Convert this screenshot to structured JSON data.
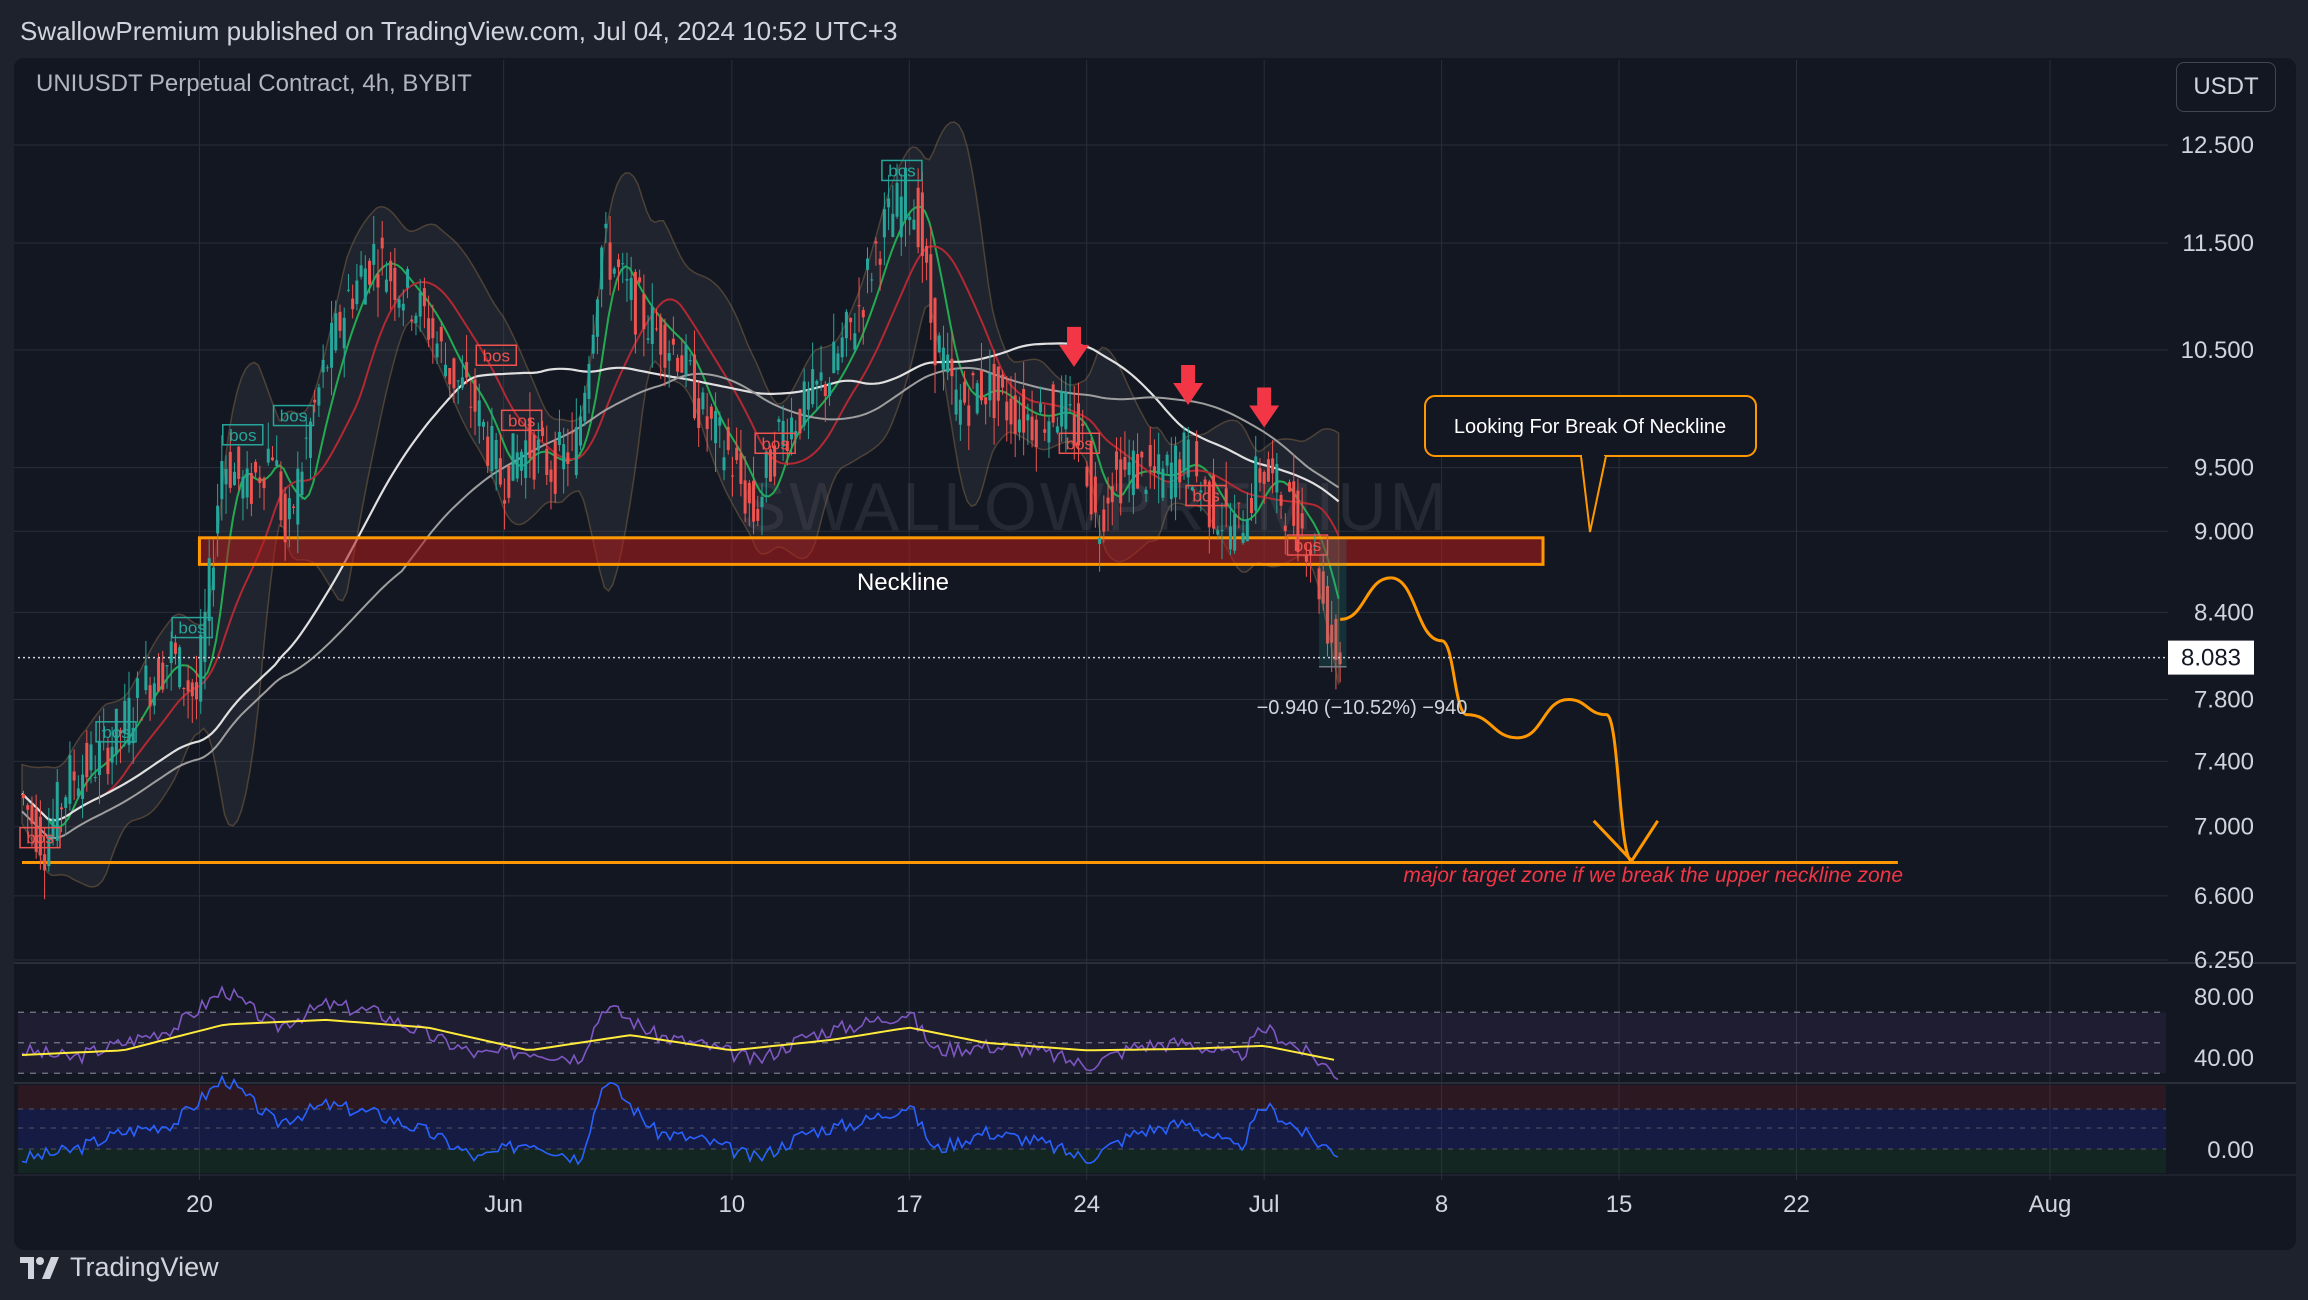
{
  "header": {
    "publish_line": "SwallowPremium published on TradingView.com, Jul 04, 2024 10:52 UTC+3"
  },
  "symbol": {
    "title": "UNIUSDT Perpetual Contract, 4h, BYBIT",
    "currency_button": "USDT"
  },
  "watermark": "SWALLOWPREMIUM",
  "footer": {
    "brand": "TradingView"
  },
  "colors": {
    "background": "#131722",
    "bull": "#26a69a",
    "bear": "#ef5350",
    "orange": "#ff9800",
    "rsi": "#7e57c2",
    "rsi_ma": "#ffeb3b",
    "osc": "#2962ff",
    "ema_fast": "#22ab52",
    "ema_mid": "#b22833",
    "ma_white": "#e0e0e0",
    "ma_grey": "#9e9e9e"
  },
  "chart_data": {
    "type": "candlestick",
    "interval": "4h",
    "price_axis": {
      "ticks": [
        12.5,
        11.5,
        10.5,
        9.5,
        9.0,
        8.4,
        7.8,
        7.4,
        7.0,
        6.6,
        6.25
      ],
      "tick_labels": [
        "12.500",
        "11.500",
        "10.500",
        "9.500",
        "9.000",
        "8.400",
        "7.800",
        "7.400",
        "7.000",
        "6.600",
        "6.250"
      ],
      "last_price": 8.083,
      "last_price_label": "8.083"
    },
    "time_axis": {
      "labels": [
        "20",
        "Jun",
        "10",
        "17",
        "24",
        "Jul",
        "8",
        "15",
        "22",
        "Aug"
      ],
      "dates": [
        "2024-05-20",
        "2024-06-01",
        "2024-06-10",
        "2024-06-17",
        "2024-06-24",
        "2024-07-01",
        "2024-07-08",
        "2024-07-15",
        "2024-07-22",
        "2024-08-01"
      ],
      "start": "2024-05-13",
      "end": "2024-08-04"
    },
    "price_path": [
      [
        "2024-05-13",
        7.2
      ],
      [
        "2024-05-14",
        6.9
      ],
      [
        "2024-05-15",
        7.3
      ],
      [
        "2024-05-16",
        7.4
      ],
      [
        "2024-05-17",
        7.6
      ],
      [
        "2024-05-18",
        7.9
      ],
      [
        "2024-05-19",
        8.1
      ],
      [
        "2024-05-20",
        7.8
      ],
      [
        "2024-05-20T12:00",
        8.6
      ],
      [
        "2024-05-21",
        9.6
      ],
      [
        "2024-05-22",
        9.3
      ],
      [
        "2024-05-23",
        9.7
      ],
      [
        "2024-05-23T12:00",
        8.9
      ],
      [
        "2024-05-24",
        9.4
      ],
      [
        "2024-05-25",
        10.3
      ],
      [
        "2024-05-26",
        11.0
      ],
      [
        "2024-05-27",
        11.4
      ],
      [
        "2024-05-28",
        11.1
      ],
      [
        "2024-05-29",
        10.8
      ],
      [
        "2024-05-30",
        10.3
      ],
      [
        "2024-05-31",
        10.0
      ],
      [
        "2024-06-01",
        9.4
      ],
      [
        "2024-06-02",
        9.7
      ],
      [
        "2024-06-03",
        9.5
      ],
      [
        "2024-06-04",
        9.7
      ],
      [
        "2024-06-05",
        11.5
      ],
      [
        "2024-06-06",
        11.0
      ],
      [
        "2024-06-07",
        10.7
      ],
      [
        "2024-06-08",
        10.5
      ],
      [
        "2024-06-09",
        9.9
      ],
      [
        "2024-06-10",
        9.6
      ],
      [
        "2024-06-11",
        9.1
      ],
      [
        "2024-06-12",
        9.8
      ],
      [
        "2024-06-13",
        10.0
      ],
      [
        "2024-06-14",
        10.3
      ],
      [
        "2024-06-15",
        10.8
      ],
      [
        "2024-06-16",
        11.6
      ],
      [
        "2024-06-17",
        12.0
      ],
      [
        "2024-06-17T12:00",
        11.7
      ],
      [
        "2024-06-18",
        10.7
      ],
      [
        "2024-06-19",
        10.0
      ],
      [
        "2024-06-20",
        10.2
      ],
      [
        "2024-06-21",
        10.0
      ],
      [
        "2024-06-22",
        9.9
      ],
      [
        "2024-06-23",
        10.0
      ],
      [
        "2024-06-24",
        9.7
      ],
      [
        "2024-06-24T12:00",
        9.0
      ],
      [
        "2024-06-25",
        9.4
      ],
      [
        "2024-06-26",
        9.5
      ],
      [
        "2024-06-27",
        9.4
      ],
      [
        "2024-06-28",
        9.6
      ],
      [
        "2024-06-29",
        9.2
      ],
      [
        "2024-06-30",
        9.0
      ],
      [
        "2024-07-01",
        9.5
      ],
      [
        "2024-07-02",
        9.2
      ],
      [
        "2024-07-03",
        8.9
      ],
      [
        "2024-07-03T12:00",
        8.4
      ],
      [
        "2024-07-04",
        8.083
      ]
    ],
    "bos_labels": [
      {
        "date": "2024-05-13",
        "price": 6.9,
        "text": "bos",
        "color": "bear"
      },
      {
        "date": "2024-05-16",
        "price": 7.55,
        "text": "bos",
        "color": "bull"
      },
      {
        "date": "2024-05-19",
        "price": 8.25,
        "text": "bos",
        "color": "bull"
      },
      {
        "date": "2024-05-21",
        "price": 9.72,
        "text": "bos",
        "color": "bull"
      },
      {
        "date": "2024-05-23",
        "price": 9.88,
        "text": "bos",
        "color": "bull"
      },
      {
        "date": "2024-05-31",
        "price": 10.4,
        "text": "bos",
        "color": "bear"
      },
      {
        "date": "2024-06-01",
        "price": 9.84,
        "text": "bos",
        "color": "bear"
      },
      {
        "date": "2024-06-11",
        "price": 9.65,
        "text": "bos",
        "color": "bear"
      },
      {
        "date": "2024-06-16",
        "price": 12.17,
        "text": "bos",
        "color": "bull"
      },
      {
        "date": "2024-06-23",
        "price": 9.65,
        "text": "bos",
        "color": "bear"
      },
      {
        "date": "2024-06-28",
        "price": 9.23,
        "text": "bos",
        "color": "bear"
      },
      {
        "date": "2024-07-02",
        "price": 8.85,
        "text": "bos",
        "color": "bear"
      }
    ],
    "down_arrows": [
      {
        "date": "2024-06-23T12:00",
        "price": 10.35
      },
      {
        "date": "2024-06-28",
        "price": 10.02
      },
      {
        "date": "2024-07-01",
        "price": 9.83
      }
    ],
    "neckline_zone": {
      "from": "2024-05-20",
      "to": "2024-07-12",
      "top": 8.95,
      "bottom": 8.75,
      "label": "Neckline"
    },
    "target_line": {
      "from": "2024-05-13",
      "to": "2024-07-26",
      "price": 6.79,
      "label": "major target zone if we break the upper neckline zone"
    },
    "callout": {
      "text": "Looking For Break Of Neckline",
      "anchor_date": "2024-07-12",
      "anchor_price": 8.95
    },
    "measure": {
      "text": "−0.940 (−10.52%) −940",
      "from": 8.94,
      "to": 8.02
    },
    "projection": [
      [
        "2024-07-04",
        8.35
      ],
      [
        "2024-07-06",
        8.65
      ],
      [
        "2024-07-08",
        8.2
      ],
      [
        "2024-07-09",
        7.7
      ],
      [
        "2024-07-11",
        7.55
      ],
      [
        "2024-07-13",
        7.8
      ],
      [
        "2024-07-14T12:00",
        7.7
      ],
      [
        "2024-07-15T12:00",
        6.8
      ]
    ],
    "rsi_panel": {
      "ticks": [
        80.0,
        40.0
      ],
      "tick_labels": [
        "80.00",
        "40.00"
      ],
      "upper_band": 70,
      "lower_band": 30,
      "series": [
        [
          "2024-05-13",
          45
        ],
        [
          "2024-05-15",
          40
        ],
        [
          "2024-05-17",
          50
        ],
        [
          "2024-05-19",
          60
        ],
        [
          "2024-05-21",
          85
        ],
        [
          "2024-05-23",
          60
        ],
        [
          "2024-05-25",
          75
        ],
        [
          "2024-05-27",
          70
        ],
        [
          "2024-05-29",
          55
        ],
        [
          "2024-05-31",
          42
        ],
        [
          "2024-06-02",
          45
        ],
        [
          "2024-06-04",
          40
        ],
        [
          "2024-06-05",
          75
        ],
        [
          "2024-06-07",
          55
        ],
        [
          "2024-06-09",
          48
        ],
        [
          "2024-06-11",
          38
        ],
        [
          "2024-06-13",
          55
        ],
        [
          "2024-06-15",
          62
        ],
        [
          "2024-06-17",
          70
        ],
        [
          "2024-06-18",
          45
        ],
        [
          "2024-06-20",
          48
        ],
        [
          "2024-06-22",
          45
        ],
        [
          "2024-06-24",
          35
        ],
        [
          "2024-06-26",
          48
        ],
        [
          "2024-06-28",
          50
        ],
        [
          "2024-06-30",
          40
        ],
        [
          "2024-07-01",
          60
        ],
        [
          "2024-07-03",
          40
        ],
        [
          "2024-07-04",
          28
        ]
      ],
      "ma": [
        [
          "2024-05-13",
          42
        ],
        [
          "2024-05-17",
          45
        ],
        [
          "2024-05-21",
          62
        ],
        [
          "2024-05-25",
          65
        ],
        [
          "2024-05-29",
          60
        ],
        [
          "2024-06-02",
          45
        ],
        [
          "2024-06-06",
          55
        ],
        [
          "2024-06-10",
          45
        ],
        [
          "2024-06-14",
          52
        ],
        [
          "2024-06-17",
          60
        ],
        [
          "2024-06-20",
          50
        ],
        [
          "2024-06-24",
          45
        ],
        [
          "2024-06-28",
          46
        ],
        [
          "2024-07-01",
          48
        ],
        [
          "2024-07-04",
          38
        ]
      ]
    },
    "osc_panel": {
      "ticks": [
        0.0
      ],
      "tick_labels": [
        "0.00"
      ],
      "series": [
        [
          "2024-05-13",
          -5
        ],
        [
          "2024-05-15",
          0
        ],
        [
          "2024-05-17",
          10
        ],
        [
          "2024-05-19",
          15
        ],
        [
          "2024-05-21",
          40
        ],
        [
          "2024-05-23",
          15
        ],
        [
          "2024-05-25",
          25
        ],
        [
          "2024-05-27",
          20
        ],
        [
          "2024-05-29",
          10
        ],
        [
          "2024-05-31",
          -5
        ],
        [
          "2024-06-02",
          5
        ],
        [
          "2024-06-04",
          -5
        ],
        [
          "2024-06-05",
          40
        ],
        [
          "2024-06-07",
          10
        ],
        [
          "2024-06-09",
          5
        ],
        [
          "2024-06-11",
          -5
        ],
        [
          "2024-06-13",
          10
        ],
        [
          "2024-06-15",
          15
        ],
        [
          "2024-06-17",
          25
        ],
        [
          "2024-06-18",
          0
        ],
        [
          "2024-06-20",
          10
        ],
        [
          "2024-06-22",
          5
        ],
        [
          "2024-06-24",
          -5
        ],
        [
          "2024-06-26",
          10
        ],
        [
          "2024-06-28",
          15
        ],
        [
          "2024-06-30",
          0
        ],
        [
          "2024-07-01",
          25
        ],
        [
          "2024-07-03",
          5
        ],
        [
          "2024-07-04",
          -2
        ]
      ]
    }
  }
}
